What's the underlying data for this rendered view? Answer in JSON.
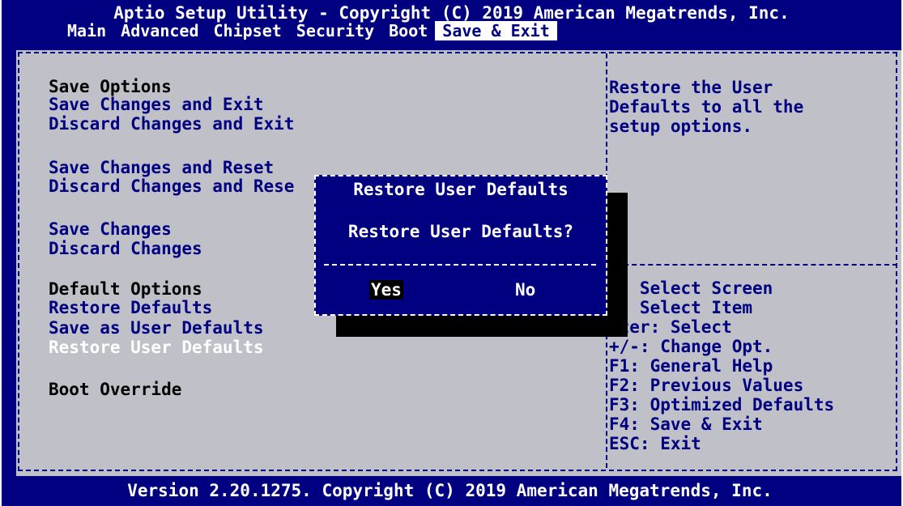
{
  "app": {
    "title": "Aptio Setup Utility - Copyright (C) 2019 American Megatrends, Inc.",
    "footer": "Version 2.20.1275. Copyright (C) 2019 American Megatrends, Inc."
  },
  "tabs": [
    {
      "label": "Main"
    },
    {
      "label": "Advanced"
    },
    {
      "label": "Chipset"
    },
    {
      "label": "Security"
    },
    {
      "label": "Boot"
    },
    {
      "label": "Save & Exit",
      "active": true
    }
  ],
  "menu": {
    "save_options_header": "Save Options",
    "save_changes_and_exit": "Save Changes and Exit",
    "discard_changes_and_exit": "Discard Changes and Exit",
    "save_changes_and_reset": "Save Changes and Reset",
    "discard_changes_and_reset": "Discard Changes and Rese",
    "save_changes": "Save Changes",
    "discard_changes": "Discard Changes",
    "default_options_header": "Default Options",
    "restore_defaults": "Restore Defaults",
    "save_as_user_defaults": "Save as User Defaults",
    "restore_user_defaults": "Restore User Defaults",
    "boot_override_header": "Boot Override"
  },
  "help": {
    "lines": [
      "Restore the User",
      "Defaults to all the",
      "setup options."
    ]
  },
  "keys": {
    "lines": [
      "<: Select Screen",
      "v: Select Item",
      "nter: Select",
      "+/-: Change Opt.",
      "F1: General Help",
      "F2: Previous Values",
      "F3: Optimized Defaults",
      "F4: Save & Exit",
      "ESC: Exit"
    ]
  },
  "dialog": {
    "title": "Restore User Defaults",
    "message": "Restore User Defaults?",
    "yes": "Yes",
    "no": "No"
  },
  "colors": {
    "background": "#000080",
    "panel": "#c0c0c8",
    "text": "#000080",
    "highlight": "#ffffff"
  }
}
